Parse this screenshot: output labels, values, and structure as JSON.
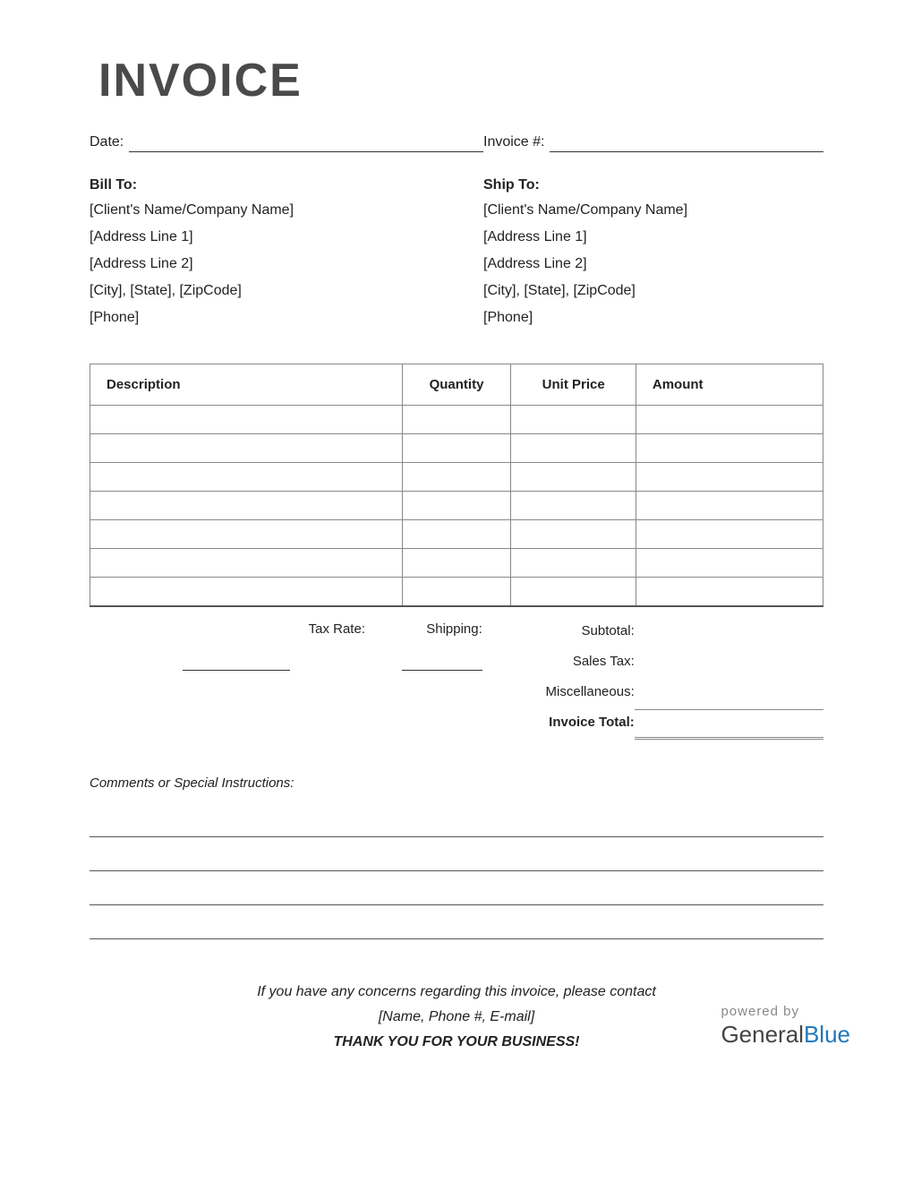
{
  "title": "INVOICE",
  "meta": {
    "date_label": "Date:",
    "invoice_label": "Invoice #:"
  },
  "bill_to": {
    "heading": "Bill To:",
    "name": "[Client's Name/Company Name]",
    "addr1": "[Address Line 1]",
    "addr2": "[Address Line 2]",
    "city": "[City], [State], [ZipCode]",
    "phone": "[Phone]"
  },
  "ship_to": {
    "heading": "Ship To:",
    "name": "[Client's Name/Company Name]",
    "addr1": "[Address Line 1]",
    "addr2": "[Address Line 2]",
    "city": "[City], [State], [ZipCode]",
    "phone": "[Phone]"
  },
  "table": {
    "headers": {
      "desc": "Description",
      "qty": "Quantity",
      "price": "Unit Price",
      "amount": "Amount"
    }
  },
  "totals": {
    "tax_rate_label": "Tax Rate:",
    "shipping_label": "Shipping:",
    "subtotal_label": "Subtotal:",
    "sales_tax_label": "Sales Tax:",
    "misc_label": "Miscellaneous:",
    "invoice_total_label": "Invoice Total:"
  },
  "comments": {
    "label": "Comments or Special Instructions:"
  },
  "footer": {
    "concern": "If you have any concerns regarding this invoice, please contact",
    "contact": "[Name, Phone #, E-mail]",
    "thanks": "THANK YOU FOR YOUR BUSINESS!",
    "powered_by": "powered by",
    "brand_general": "General",
    "brand_blue": "Blue"
  }
}
